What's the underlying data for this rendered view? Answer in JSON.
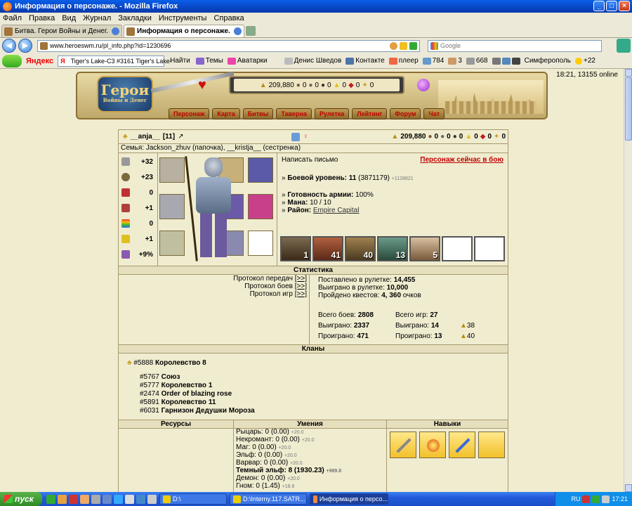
{
  "window": {
    "title": "Информация о персонаже. - Mozilla Firefox"
  },
  "menu": [
    "Файл",
    "Правка",
    "Вид",
    "Журнал",
    "Закладки",
    "Инструменты",
    "Справка"
  ],
  "tabs": [
    {
      "label": "Битва. Герои Войны и Денег.",
      "active": false
    },
    {
      "label": "Информация о персонаже.",
      "active": true
    }
  ],
  "nav": {
    "url": "www.heroeswm.ru/pl_info.php?id=1230696",
    "search_placeholder": "Google"
  },
  "yandex": {
    "logo": "Яндекс",
    "input_value": "Tiger's Lake-C3      #3161      Tiger's Lake-",
    "find": "Найти",
    "themes": "Темы",
    "avatars": "Аватарки",
    "user": "Денис Шведов",
    "vk": "Контакте",
    "player": "плеер",
    "mail_count": "784",
    "count2": "3",
    "count3": "668",
    "city": "Симферополь",
    "temp": "+22"
  },
  "page": {
    "online": "18:21, 13155 online",
    "banner": {
      "logo_big": "Герои",
      "logo_small": "Войны и Денег",
      "gold": "209,880",
      "res": [
        "0",
        "0",
        "0",
        "0",
        "0",
        "0"
      ]
    },
    "nav_items": [
      "Персонаж",
      "Карта",
      "Битвы",
      "Таверна",
      "Рулетка",
      "Лейтинг",
      "Форум",
      "Чат"
    ],
    "hero": {
      "nick": "__anja__",
      "level": "[11]",
      "gold": "209,880",
      "res": [
        "0",
        "0",
        "0",
        "0",
        "0",
        "0"
      ],
      "family": "Семья: Jackson_zhuv (папочка), __kristja__ (сестренка)",
      "stats": [
        "+32",
        "+23",
        "0",
        "+1",
        "0",
        "+1",
        "+9%"
      ],
      "write": "Написать письмо",
      "in_battle": "Персонаж сейчас в бою",
      "combat_label": "Боевой уровень:",
      "combat_level": "11",
      "combat_exp": "(3871179)",
      "combat_next": "+1128821",
      "army_label": "Готовность армии:",
      "army_value": "100%",
      "mana_label": "Мана:",
      "mana_value": "10 / 10",
      "district_label": "Район:",
      "district_value": "Empire Capital",
      "army": [
        "1",
        "41",
        "40",
        "13",
        "5",
        "",
        ""
      ]
    },
    "stats": {
      "title": "Статистика",
      "protocols": [
        {
          "label": "Протокол передач",
          "link": "[>>]"
        },
        {
          "label": "Протокол боев",
          "link": "[>>]"
        },
        {
          "label": "Протокол игр",
          "link": "[>>]"
        }
      ],
      "roulette_bet_label": "Поставлено в рулетке:",
      "roulette_bet": "14,455",
      "roulette_won_label": "Выиграно в рулетке:",
      "roulette_won": "10,000",
      "quests_label": "Пройдено квестов:",
      "quests": "4, 360",
      "quests_unit": "очков",
      "battles_total_label": "Всего боев:",
      "battles_total": "2808",
      "battles_won_label": "Выиграно:",
      "battles_won": "2337",
      "battles_lost_label": "Проиграно:",
      "battles_lost": "471",
      "games_total_label": "Всего игр:",
      "games_total": "27",
      "games_won_label": "Выиграно:",
      "games_won": "14",
      "games_lost_label": "Проиграно:",
      "games_lost": "13",
      "gold_won": "38",
      "gold_lost": "40"
    },
    "clans": {
      "title": "Кланы",
      "main": {
        "id": "#5888",
        "name": "Королевство 8"
      },
      "list": [
        {
          "id": "#5767",
          "name": "Союз"
        },
        {
          "id": "#5777",
          "name": "Королевство 1"
        },
        {
          "id": "#2474",
          "name": "Order of blazing rose"
        },
        {
          "id": "#5891",
          "name": "Королевство 11"
        },
        {
          "id": "#6031",
          "name": "Гарнизон Дедушки Мороза"
        }
      ]
    },
    "resources": {
      "title": "Ресурсы"
    },
    "skills": {
      "title": "Умения",
      "items": [
        {
          "name": "Рыцарь:",
          "value": "0 (0.00)",
          "bonus": "+20.0",
          "bold": false
        },
        {
          "name": "Некромант:",
          "value": "0 (0.00)",
          "bonus": "+20.0",
          "bold": false
        },
        {
          "name": "Маг:",
          "value": "0 (0.00)",
          "bonus": "+20.0",
          "bold": false
        },
        {
          "name": "Эльф:",
          "value": "0 (0.00)",
          "bonus": "+20.0",
          "bold": false
        },
        {
          "name": "Варвар:",
          "value": "0 (0.00)",
          "bonus": "+20.0",
          "bold": false
        },
        {
          "name": "Темный эльф:",
          "value": "8 (1930.23)",
          "bonus": "+989.8",
          "bold": true
        },
        {
          "name": "Демон:",
          "value": "0 (0.00)",
          "bonus": "+20.0",
          "bold": false
        },
        {
          "name": "Гном:",
          "value": "0 (1.45)",
          "bonus": "+18.6",
          "bold": false
        }
      ]
    },
    "perks": {
      "title": "Навыки"
    }
  },
  "taskbar": {
    "start": "пуск",
    "items": [
      {
        "label": "D:\\",
        "active": false
      },
      {
        "label": "D:\\Interny.117.SATR...",
        "active": false
      },
      {
        "label": "Информация о персо...",
        "active": true
      }
    ],
    "lang": "RU",
    "time": "17:21"
  }
}
